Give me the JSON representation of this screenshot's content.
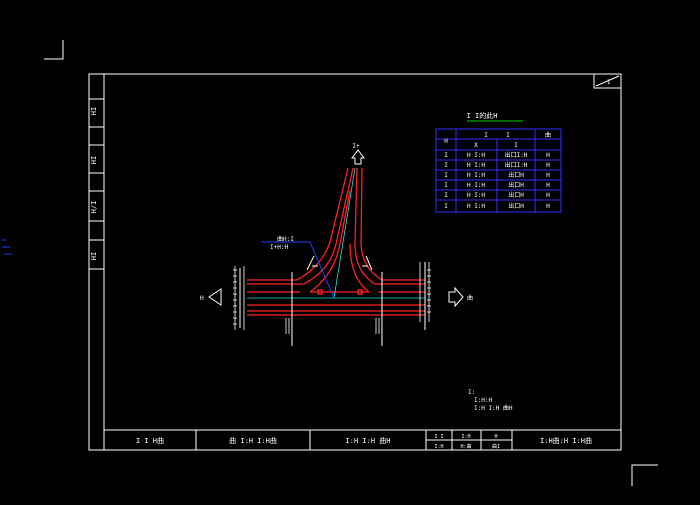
{
  "colors": {
    "background": "#000000",
    "frame": "#ffffff",
    "road": "#ff2020",
    "centerline": "#20e0e0",
    "annotation": "#2040ff",
    "table": "#3030ff",
    "table_title_underline": "#00d000",
    "text": "#ffffff"
  },
  "drawing": {
    "table": {
      "title": "I I的此H",
      "header_row1": [
        "H",
        "I",
        "I",
        "曲"
      ],
      "header_row2": [
        "X",
        "I"
      ],
      "rows": [
        [
          "I",
          "H I:H",
          "出口I:H",
          "H"
        ],
        [
          "I",
          "H I:H",
          "出口I:H",
          "H"
        ],
        [
          "I",
          "H I:H",
          "出口H",
          "H"
        ],
        [
          "I",
          "H I:H",
          "出口H",
          "H"
        ],
        [
          "I",
          "H I:H",
          "出口H",
          "H"
        ],
        [
          "I",
          "H I:H",
          "出口H",
          "H"
        ]
      ]
    },
    "north_label": "I+",
    "callout_lines": [
      "曲H:I",
      "I+H:H"
    ],
    "left_direction": "H",
    "right_direction": "曲",
    "notes": [
      "I:",
      "I:H:H",
      "I:H I:H 曲H"
    ]
  },
  "side_tabs": [
    "HI",
    "HI",
    "H/I",
    "HI"
  ],
  "title_block": {
    "cell1": "I I H曲",
    "cell2": "曲 I:H I:H曲",
    "cell3": "I:H I:H 曲H",
    "cell4a": "I I",
    "cell4b": "I:H",
    "cell5a": "I:H",
    "cell5b": "H:曲",
    "cell6a": "H",
    "cell6b": "曲I",
    "cell7": "I:H曲:H I:H曲"
  },
  "corner_label": "I"
}
